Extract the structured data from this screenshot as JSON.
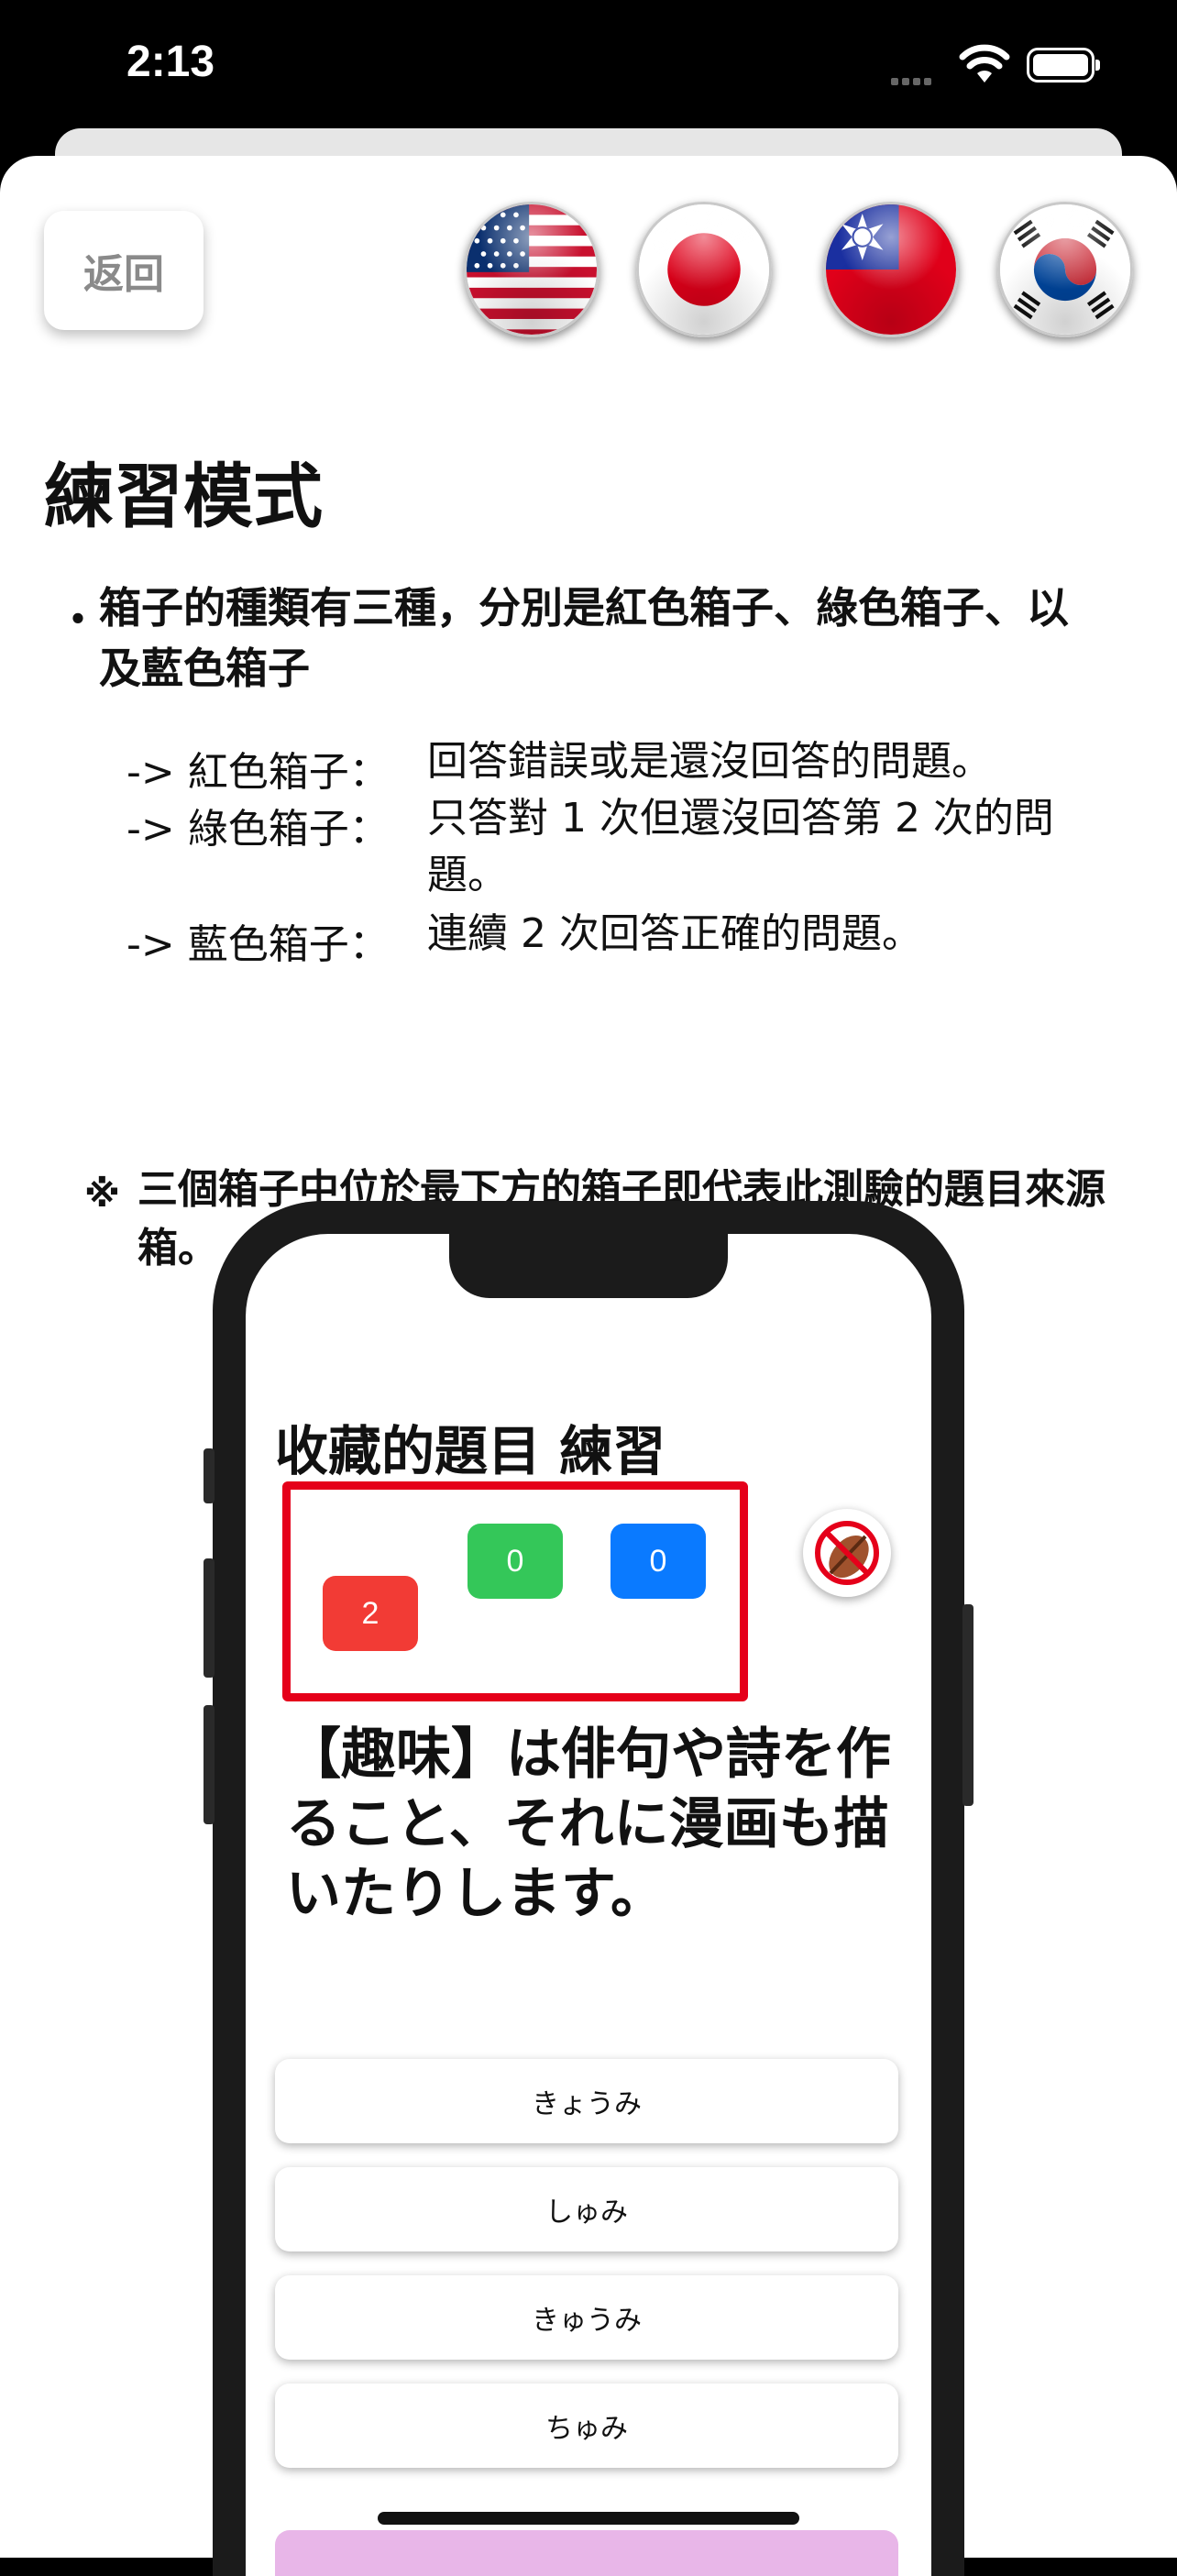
{
  "status": {
    "time": "2:13"
  },
  "header": {
    "back_label": "返回",
    "flags": [
      "us-flag-icon",
      "japan-flag-icon",
      "taiwan-flag-icon",
      "korea-flag-icon"
    ]
  },
  "content": {
    "title": "練習模式",
    "bullet": "・",
    "bullet_text": "箱子的種類有三種，分別是紅色箱子、綠色箱子、以及藍色箱子",
    "boxes": [
      {
        "label": "-> 紅色箱子：",
        "desc": "回答錯誤或是還沒回答的問題。"
      },
      {
        "label": "-> 綠色箱子：",
        "desc": "只答對 1 次但還沒回答第 2 次的問題。"
      },
      {
        "label": "-> 藍色箱子：",
        "desc": "連續 2 次回答正確的問題。"
      }
    ],
    "note_mark": "※",
    "note_text": "三個箱子中位於最下方的箱子即代表此測驗的題目來源箱。"
  },
  "mockup": {
    "title": "收藏的題目 練習",
    "counters": {
      "red": "2",
      "green": "0",
      "blue": "0"
    },
    "question": "【趣味】は俳句や詩を作ること、それに漫画も描いたりします。",
    "answers": [
      "きょうみ",
      "しゅみ",
      "きゅうみ",
      "ちゅみ"
    ]
  },
  "colors": {
    "red": "#f23b35",
    "green": "#34c759",
    "blue": "#0a7aff",
    "highlight": "#e5001a"
  }
}
